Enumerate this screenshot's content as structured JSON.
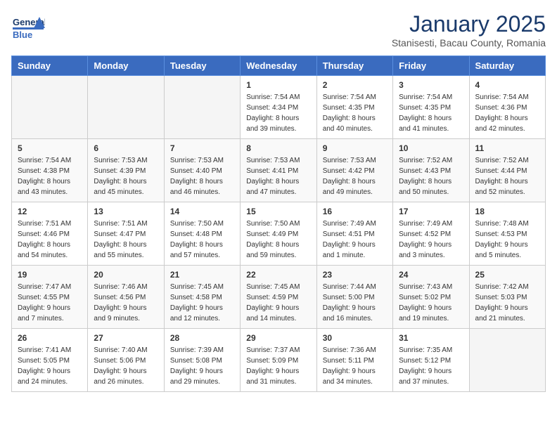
{
  "header": {
    "logo_general": "General",
    "logo_blue": "Blue",
    "title": "January 2025",
    "subtitle": "Stanisesti, Bacau County, Romania"
  },
  "weekdays": [
    "Sunday",
    "Monday",
    "Tuesday",
    "Wednesday",
    "Thursday",
    "Friday",
    "Saturday"
  ],
  "weeks": [
    [
      {
        "day": "",
        "info": ""
      },
      {
        "day": "",
        "info": ""
      },
      {
        "day": "",
        "info": ""
      },
      {
        "day": "1",
        "info": "Sunrise: 7:54 AM\nSunset: 4:34 PM\nDaylight: 8 hours\nand 39 minutes."
      },
      {
        "day": "2",
        "info": "Sunrise: 7:54 AM\nSunset: 4:35 PM\nDaylight: 8 hours\nand 40 minutes."
      },
      {
        "day": "3",
        "info": "Sunrise: 7:54 AM\nSunset: 4:35 PM\nDaylight: 8 hours\nand 41 minutes."
      },
      {
        "day": "4",
        "info": "Sunrise: 7:54 AM\nSunset: 4:36 PM\nDaylight: 8 hours\nand 42 minutes."
      }
    ],
    [
      {
        "day": "5",
        "info": "Sunrise: 7:54 AM\nSunset: 4:38 PM\nDaylight: 8 hours\nand 43 minutes."
      },
      {
        "day": "6",
        "info": "Sunrise: 7:53 AM\nSunset: 4:39 PM\nDaylight: 8 hours\nand 45 minutes."
      },
      {
        "day": "7",
        "info": "Sunrise: 7:53 AM\nSunset: 4:40 PM\nDaylight: 8 hours\nand 46 minutes."
      },
      {
        "day": "8",
        "info": "Sunrise: 7:53 AM\nSunset: 4:41 PM\nDaylight: 8 hours\nand 47 minutes."
      },
      {
        "day": "9",
        "info": "Sunrise: 7:53 AM\nSunset: 4:42 PM\nDaylight: 8 hours\nand 49 minutes."
      },
      {
        "day": "10",
        "info": "Sunrise: 7:52 AM\nSunset: 4:43 PM\nDaylight: 8 hours\nand 50 minutes."
      },
      {
        "day": "11",
        "info": "Sunrise: 7:52 AM\nSunset: 4:44 PM\nDaylight: 8 hours\nand 52 minutes."
      }
    ],
    [
      {
        "day": "12",
        "info": "Sunrise: 7:51 AM\nSunset: 4:46 PM\nDaylight: 8 hours\nand 54 minutes."
      },
      {
        "day": "13",
        "info": "Sunrise: 7:51 AM\nSunset: 4:47 PM\nDaylight: 8 hours\nand 55 minutes."
      },
      {
        "day": "14",
        "info": "Sunrise: 7:50 AM\nSunset: 4:48 PM\nDaylight: 8 hours\nand 57 minutes."
      },
      {
        "day": "15",
        "info": "Sunrise: 7:50 AM\nSunset: 4:49 PM\nDaylight: 8 hours\nand 59 minutes."
      },
      {
        "day": "16",
        "info": "Sunrise: 7:49 AM\nSunset: 4:51 PM\nDaylight: 9 hours\nand 1 minute."
      },
      {
        "day": "17",
        "info": "Sunrise: 7:49 AM\nSunset: 4:52 PM\nDaylight: 9 hours\nand 3 minutes."
      },
      {
        "day": "18",
        "info": "Sunrise: 7:48 AM\nSunset: 4:53 PM\nDaylight: 9 hours\nand 5 minutes."
      }
    ],
    [
      {
        "day": "19",
        "info": "Sunrise: 7:47 AM\nSunset: 4:55 PM\nDaylight: 9 hours\nand 7 minutes."
      },
      {
        "day": "20",
        "info": "Sunrise: 7:46 AM\nSunset: 4:56 PM\nDaylight: 9 hours\nand 9 minutes."
      },
      {
        "day": "21",
        "info": "Sunrise: 7:45 AM\nSunset: 4:58 PM\nDaylight: 9 hours\nand 12 minutes."
      },
      {
        "day": "22",
        "info": "Sunrise: 7:45 AM\nSunset: 4:59 PM\nDaylight: 9 hours\nand 14 minutes."
      },
      {
        "day": "23",
        "info": "Sunrise: 7:44 AM\nSunset: 5:00 PM\nDaylight: 9 hours\nand 16 minutes."
      },
      {
        "day": "24",
        "info": "Sunrise: 7:43 AM\nSunset: 5:02 PM\nDaylight: 9 hours\nand 19 minutes."
      },
      {
        "day": "25",
        "info": "Sunrise: 7:42 AM\nSunset: 5:03 PM\nDaylight: 9 hours\nand 21 minutes."
      }
    ],
    [
      {
        "day": "26",
        "info": "Sunrise: 7:41 AM\nSunset: 5:05 PM\nDaylight: 9 hours\nand 24 minutes."
      },
      {
        "day": "27",
        "info": "Sunrise: 7:40 AM\nSunset: 5:06 PM\nDaylight: 9 hours\nand 26 minutes."
      },
      {
        "day": "28",
        "info": "Sunrise: 7:39 AM\nSunset: 5:08 PM\nDaylight: 9 hours\nand 29 minutes."
      },
      {
        "day": "29",
        "info": "Sunrise: 7:37 AM\nSunset: 5:09 PM\nDaylight: 9 hours\nand 31 minutes."
      },
      {
        "day": "30",
        "info": "Sunrise: 7:36 AM\nSunset: 5:11 PM\nDaylight: 9 hours\nand 34 minutes."
      },
      {
        "day": "31",
        "info": "Sunrise: 7:35 AM\nSunset: 5:12 PM\nDaylight: 9 hours\nand 37 minutes."
      },
      {
        "day": "",
        "info": ""
      }
    ]
  ]
}
